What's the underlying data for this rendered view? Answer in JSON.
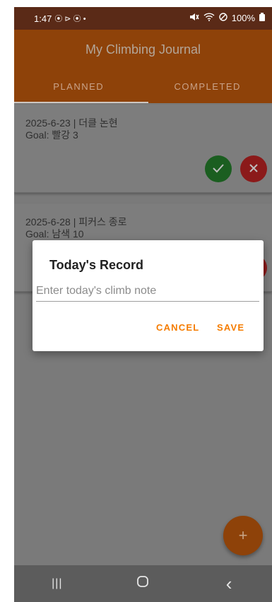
{
  "status_bar": {
    "time": "1:47",
    "left_icons": "⦿ ⊳ ⦿ •",
    "battery": "100%"
  },
  "app_bar": {
    "title": "My Climbing Journal"
  },
  "tabs": [
    {
      "label": "PLANNED",
      "selected": true
    },
    {
      "label": "COMPLETED",
      "selected": false
    }
  ],
  "entries": [
    {
      "date_location": "2025-6-23 | 더클 논현",
      "goal": "Goal: 빨강 3"
    },
    {
      "date_location": "2025-6-28 | 피커스 종로",
      "goal": "Goal: 남색 10"
    }
  ],
  "dialog": {
    "title": "Today's Record",
    "placeholder": "Enter today's climb note",
    "cancel": "CANCEL",
    "save": "SAVE"
  },
  "fab": {
    "icon": "plus-icon",
    "glyph": "+"
  },
  "nav": {
    "recents": "|||",
    "home": "◯",
    "back": "‹"
  },
  "colors": {
    "accent": "#f57c00",
    "primary": "#8e4209",
    "complete": "#1b5e20",
    "delete": "#8b1a1a"
  }
}
